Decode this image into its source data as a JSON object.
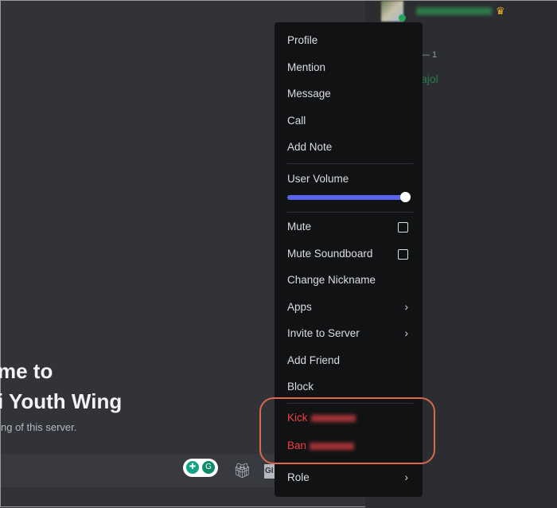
{
  "members": {
    "count_label": "— 1",
    "member_name": "ajol",
    "crown_icon": "crown-icon"
  },
  "welcome": {
    "line1": "me to",
    "line2": "i Youth Wing",
    "subtitle": "ng of this server."
  },
  "composer": {
    "gif_label": "GI"
  },
  "menu": {
    "profile": "Profile",
    "mention": "Mention",
    "message": "Message",
    "call": "Call",
    "add_note": "Add Note",
    "user_volume": "User Volume",
    "volume_percent": 100,
    "mute": "Mute",
    "mute_soundboard": "Mute Soundboard",
    "change_nickname": "Change Nickname",
    "apps": "Apps",
    "invite": "Invite to Server",
    "add_friend": "Add Friend",
    "block": "Block",
    "kick": "Kick",
    "ban": "Ban",
    "role": "Role"
  },
  "colors": {
    "danger": "#f23f43",
    "accent": "#5865f2",
    "highlight": "#d9694a"
  }
}
